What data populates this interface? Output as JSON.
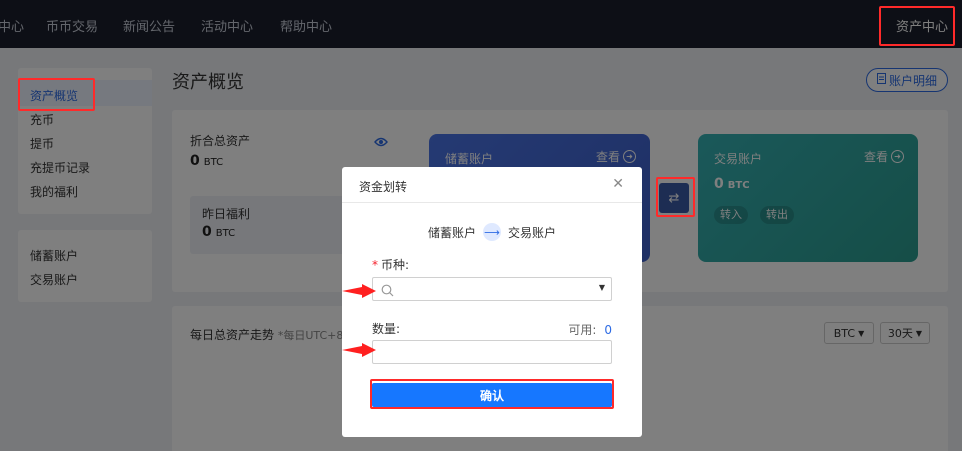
{
  "nav": {
    "items": [
      "中心",
      "币币交易",
      "新闻公告",
      "活动中心",
      "帮助中心"
    ],
    "right": "资产中心"
  },
  "sidebar": {
    "group1": [
      "资产概览",
      "充币",
      "提币",
      "充提币记录",
      "我的福利"
    ],
    "group2": [
      "储蓄账户",
      "交易账户"
    ]
  },
  "main": {
    "title": "资产概览",
    "ledger_button": "账户明细",
    "total_label": "折合总资产",
    "total_value": "0",
    "total_unit": "BTC",
    "yesterday_label": "昨日福利",
    "yesterday_value": "0",
    "yesterday_unit": "BTC",
    "savings": {
      "title": "储蓄账户",
      "link": "查看"
    },
    "trading": {
      "title": "交易账户",
      "link": "查看",
      "value": "0",
      "unit": "BTC",
      "btn_in": "转入",
      "btn_out": "转出"
    },
    "trend_label": "每日总资产走势",
    "trend_note": "*每日UTC+8",
    "coin_select": "BTC",
    "period_select": "30天"
  },
  "modal": {
    "title": "资金划转",
    "from": "储蓄账户",
    "to": "交易账户",
    "coin_label": "币种:",
    "coin_value": "",
    "amount_label": "数量:",
    "amount_value": "",
    "available_label": "可用:",
    "available_value": "0",
    "confirm": "确认"
  },
  "colors": {
    "accent": "#1677ff",
    "highlight": "#ff2a2a",
    "nav_bg": "#1b1f2c"
  }
}
